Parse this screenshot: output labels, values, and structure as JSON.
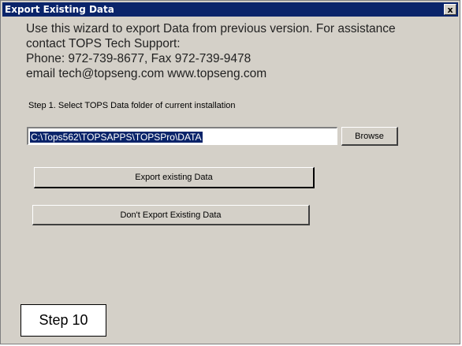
{
  "window": {
    "title": "Export Existing Data",
    "close_label": "x"
  },
  "intro": {
    "lines": [
      "Use this wizard to export Data from previous version.  For assistance",
      "contact TOPS Tech Support:",
      "Phone: 972-739-8677,  Fax 972-739-9478",
      "email tech@topseng.com  www.topseng.com"
    ]
  },
  "step1": {
    "label": "Step 1.  Select TOPS Data folder of current installation",
    "path_value": "C:\\Tops562\\TOPSAPPS\\TOPSPro\\DATA",
    "browse_label": "Browse"
  },
  "buttons": {
    "export_label": "Export existing Data",
    "no_export_label": "Don't Export Existing Data"
  },
  "annotation": {
    "step_label": "Step 10"
  },
  "colors": {
    "titlebar": "#0a246a",
    "dialog_face": "#d4d0c8",
    "selection": "#0a246a"
  }
}
